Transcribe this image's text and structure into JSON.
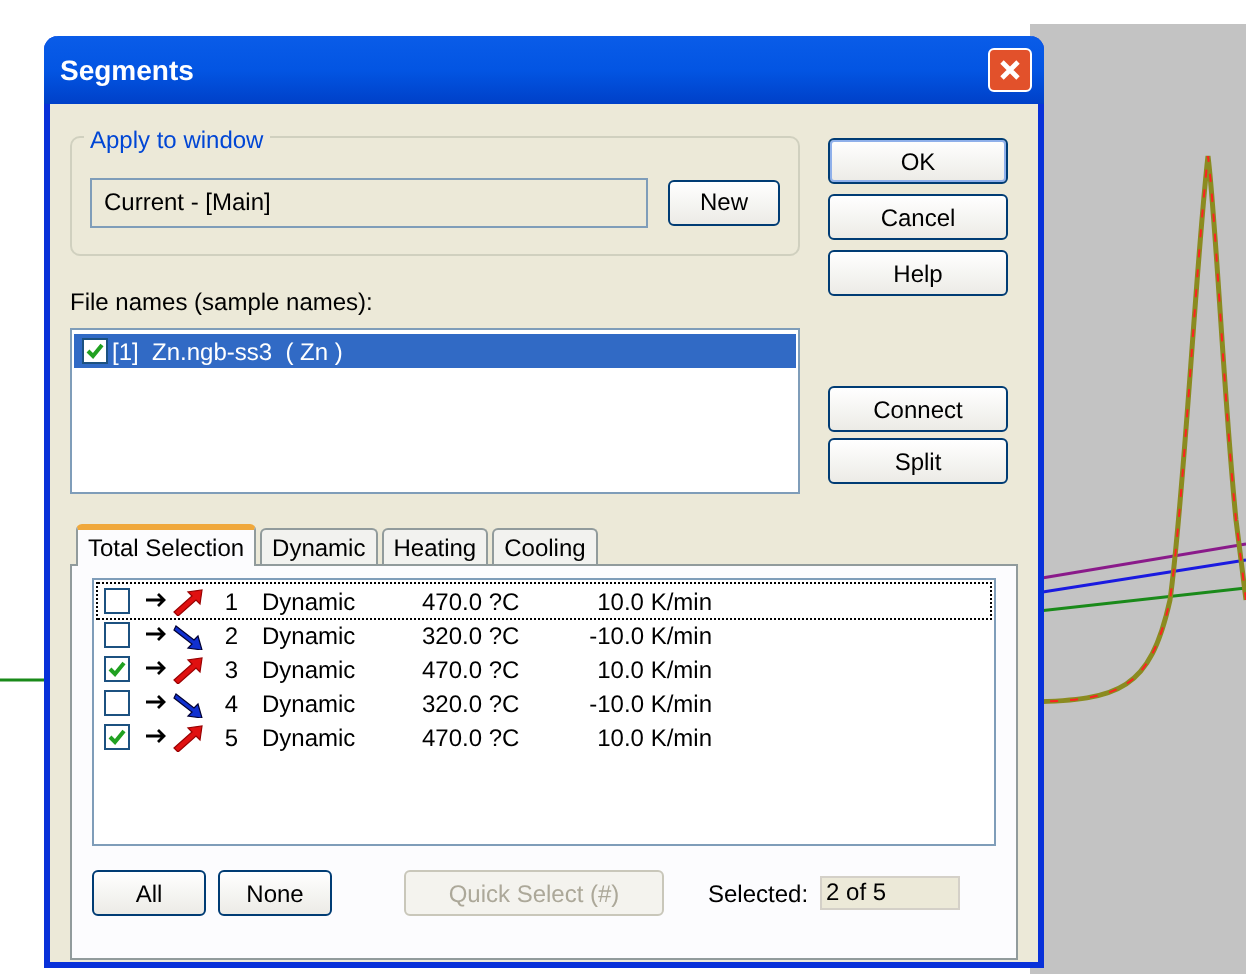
{
  "window": {
    "title": "Segments"
  },
  "apply_to_window": {
    "label": "Apply to window",
    "value": "Current - [Main]",
    "button": "New"
  },
  "file_names": {
    "label": "File names (sample names):",
    "items": [
      {
        "checked": true,
        "selected": true,
        "label": "[1]  Zn.ngb-ss3  ( Zn )"
      }
    ]
  },
  "side_buttons": [
    {
      "label": "OK",
      "default": true
    },
    {
      "label": "Cancel",
      "default": false
    },
    {
      "label": "Help",
      "default": false
    }
  ],
  "segment_buttons": [
    {
      "label": "Connect"
    },
    {
      "label": "Split"
    }
  ],
  "tabs": [
    {
      "label": "Total Selection",
      "selected": true
    },
    {
      "label": "Dynamic",
      "selected": false
    },
    {
      "label": "Heating",
      "selected": false
    },
    {
      "label": "Cooling",
      "selected": false
    }
  ],
  "segments": [
    {
      "checked": false,
      "focused": true,
      "kind": "heating",
      "number": "1",
      "type": "Dynamic",
      "temperature": "470.0 ?C",
      "rate": "10.0 K/min"
    },
    {
      "checked": false,
      "focused": false,
      "kind": "cooling",
      "number": "2",
      "type": "Dynamic",
      "temperature": "320.0 ?C",
      "rate": "-10.0 K/min"
    },
    {
      "checked": true,
      "focused": false,
      "kind": "heating",
      "number": "3",
      "type": "Dynamic",
      "temperature": "470.0 ?C",
      "rate": "10.0 K/min"
    },
    {
      "checked": false,
      "focused": false,
      "kind": "cooling",
      "number": "4",
      "type": "Dynamic",
      "temperature": "320.0 ?C",
      "rate": "-10.0 K/min"
    },
    {
      "checked": true,
      "focused": false,
      "kind": "heating",
      "number": "5",
      "type": "Dynamic",
      "temperature": "470.0 ?C",
      "rate": "10.0 K/min"
    }
  ],
  "bottom": {
    "all_button": "All",
    "none_button": "None",
    "quick_select": {
      "label": "Quick Select (#)",
      "disabled": true
    },
    "selected_label": "Selected:",
    "selected_value": "2 of 5"
  }
}
